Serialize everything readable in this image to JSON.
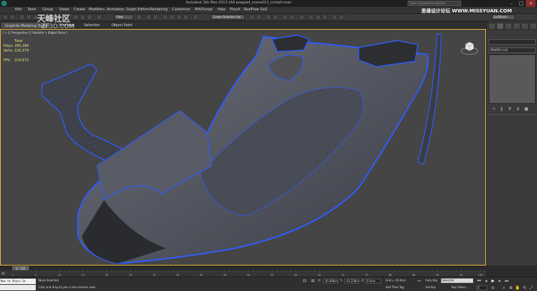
{
  "window": {
    "title": "Autodesk 3ds Max 2013 x64   prepped_scene013_cockpit.max",
    "search_placeholder": "Type a keyword or phrase"
  },
  "menu": [
    "Edit",
    "Tools",
    "Group",
    "Views",
    "Create",
    "Modifiers",
    "Animation",
    "Graph Editors",
    "Rendering",
    "Customize",
    "MAXScript",
    "Help",
    "PhysX",
    "RealFlow",
    "GoZ"
  ],
  "toolbar": {
    "selection_filter": "View",
    "named_selection": "Create Selection Set",
    "gozbrush_label": "GoZBrush"
  },
  "ribbon": {
    "tabs": [
      "Graphite Modeling Tools",
      "Freeform",
      "Selection",
      "Object Paint"
    ]
  },
  "viewport": {
    "label": "[ + ] [ Perspective ] [ Realistic + Edged Faces ]",
    "stats": {
      "header": "Total",
      "rows": [
        {
          "key": "Polys:",
          "value": "295,266"
        },
        {
          "key": "Verts:",
          "value": "156,379"
        }
      ],
      "fps_key": "FPS:",
      "fps_value": "224.672"
    }
  },
  "command_panel": {
    "modifier_list": "Modifier List"
  },
  "timeline": {
    "slider_label": "0 / 100",
    "ticks": [
      "0",
      "5",
      "10",
      "15",
      "20",
      "25",
      "30",
      "35",
      "40",
      "45",
      "50",
      "55",
      "60",
      "65",
      "70",
      "75",
      "80",
      "85",
      "90",
      "95",
      "100"
    ]
  },
  "status": {
    "maxscript_text": "Max to Physc Se",
    "selection_status": "None Selected",
    "prompt": "Click and drag to pan a non-camera view",
    "x_label": "X:",
    "x_value": "-81.608cm",
    "y_label": "Y:",
    "y_value": "-61.228cm",
    "z_label": "Z:",
    "z_value": "0.0cm",
    "grid": "Grid = 10.0cm",
    "add_time_tag": "Add Time Tag",
    "auto_key": "Auto Key",
    "selected_option": "Selected",
    "set_key": "Set Key",
    "key_filters": "Key Filters...",
    "frame": "0"
  },
  "watermarks": {
    "left_top": "天峰社区",
    "left_bottom": "ZF3D.COM",
    "right_top": "思缘设计论坛 WWW.MISSYUAN.COM"
  },
  "colors": {
    "viewport_bg": "#454545",
    "wire": "#2f5cff",
    "stats_text": "#e8e27a",
    "active_border": "#f0c040"
  }
}
